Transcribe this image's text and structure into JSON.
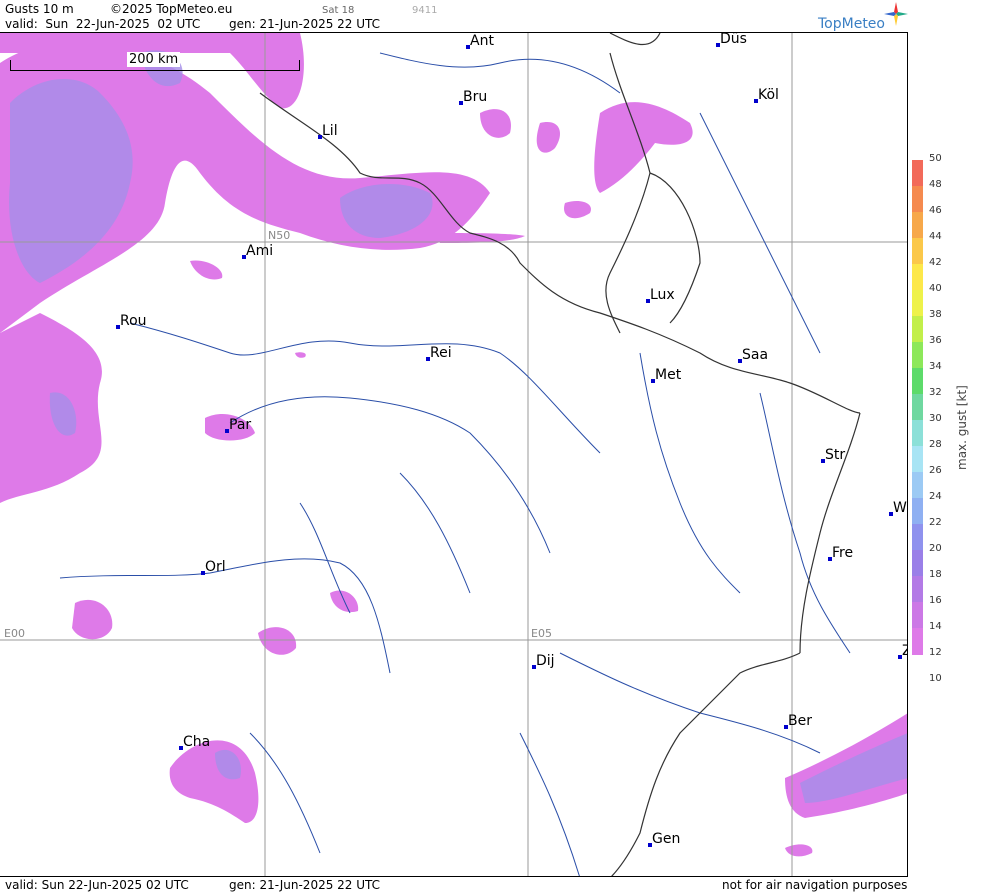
{
  "header": {
    "product": "Gusts 10 m",
    "copyright": "©2025 TopMeteo.eu",
    "sat": "Sat 18",
    "code": "9411",
    "valid": "valid:  Sun  22-Jun-2025  02 UTC",
    "gen": "gen: 21-Jun-2025 22 UTC",
    "brand": "TopMeteo"
  },
  "scale": {
    "label": "200 km"
  },
  "grid": {
    "lat": "N50",
    "lon0": "E00",
    "lon5": "E05"
  },
  "cities": [
    {
      "id": "ant",
      "label": "Ant"
    },
    {
      "id": "dus",
      "label": "Düs"
    },
    {
      "id": "bru",
      "label": "Bru"
    },
    {
      "id": "kol",
      "label": "Köl"
    },
    {
      "id": "lil",
      "label": "Lil"
    },
    {
      "id": "ami",
      "label": "Ami"
    },
    {
      "id": "rou",
      "label": "Rou"
    },
    {
      "id": "lux",
      "label": "Lux"
    },
    {
      "id": "rei",
      "label": "Rei"
    },
    {
      "id": "saa",
      "label": "Saa"
    },
    {
      "id": "met",
      "label": "Met"
    },
    {
      "id": "par",
      "label": "Par"
    },
    {
      "id": "str",
      "label": "Str"
    },
    {
      "id": "wa",
      "label": "W"
    },
    {
      "id": "orl",
      "label": "Orl"
    },
    {
      "id": "fre",
      "label": "Fre"
    },
    {
      "id": "dij",
      "label": "Dij"
    },
    {
      "id": "ber",
      "label": "Ber"
    },
    {
      "id": "cha",
      "label": "Cha"
    },
    {
      "id": "gen",
      "label": "Gen"
    },
    {
      "id": "zu",
      "label": "Z"
    }
  ],
  "legend": {
    "title": "max. gust [kt]",
    "ticks": [
      "50",
      "48",
      "46",
      "44",
      "42",
      "40",
      "38",
      "36",
      "34",
      "32",
      "30",
      "28",
      "26",
      "24",
      "22",
      "20",
      "18",
      "16",
      "14",
      "12",
      "10"
    ],
    "colors": [
      "#f26a5a",
      "#f58a4f",
      "#f7a84a",
      "#fbc84a",
      "#fde84a",
      "#eef24a",
      "#c2ef4a",
      "#8de85a",
      "#5ddb6a",
      "#6fd8a0",
      "#8ce0d8",
      "#a8e4f4",
      "#9ccaf4",
      "#8fb0f2",
      "#8f92ee",
      "#9a7fe8",
      "#b37ae6",
      "#cc78e6",
      "#de7ae8"
    ]
  },
  "footer": {
    "valid": "valid:  Sun  22-Jun-2025  02 UTC",
    "gen": "gen: 21-Jun-2025 22 UTC",
    "note": "not for air navigation purposes"
  }
}
